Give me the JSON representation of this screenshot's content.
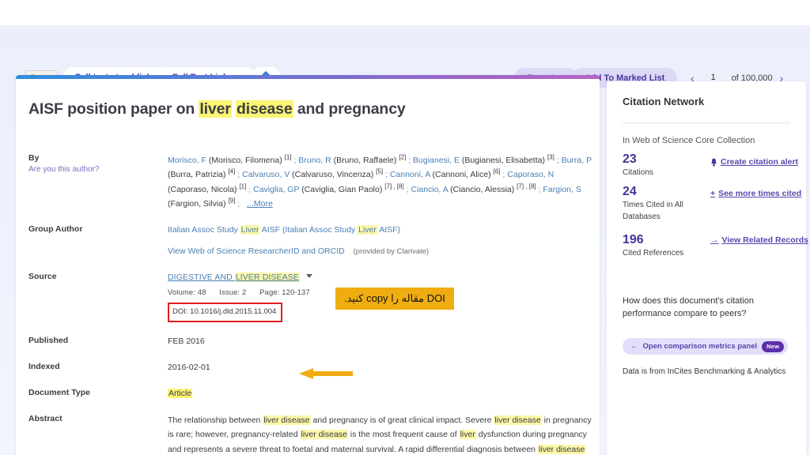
{
  "toolbar": {
    "find_it_label": "Find It",
    "find_it_icon": "circle-ring-icon",
    "full_text_publisher": "Full text at publisher",
    "full_text_links": "Full Text Links",
    "gem_icon": "blue-diamond-icon",
    "export_label": "Export",
    "add_to_marked_list": "Add To Marked List",
    "pager": {
      "prev_icon": "chevron-left-icon",
      "next_icon": "chevron-right-icon",
      "current": "1",
      "of_text": "of 100,000"
    }
  },
  "record": {
    "title_parts": [
      {
        "text": "AISF position paper on ",
        "highlight": false
      },
      {
        "text": "liver",
        "highlight": true
      },
      {
        "text": " ",
        "highlight": false
      },
      {
        "text": "disease",
        "highlight": true
      },
      {
        "text": " and pregnancy",
        "highlight": false
      }
    ],
    "title_plain": "AISF position paper on liver disease and pregnancy",
    "by_label": "By",
    "by_sublabel": "Are you this author?",
    "authors": [
      {
        "link": "Morisco, F",
        "full": "(Morisco, Filomena)",
        "refs": "[1]"
      },
      {
        "link": "Bruno, R",
        "full": "(Bruno, Raffaele)",
        "refs": "[2]"
      },
      {
        "link": "Bugianesi, E",
        "full": "(Bugianesi, Elisabetta)",
        "refs": "[3]"
      },
      {
        "link": "Burra, P",
        "full": "(Burra, Patrizia)",
        "refs": "[4]"
      },
      {
        "link": "Calvaruso, V",
        "full": "(Calvaruso, Vincenza)",
        "refs": "[5]"
      },
      {
        "link": "Cannoni, A",
        "full": "(Cannoni, Alice)",
        "refs": "[6]"
      },
      {
        "link": "Caporaso, N",
        "full": "(Caporaso, Nicola)",
        "refs": "[1]"
      },
      {
        "link": "Caviglia, GP",
        "full": "(Caviglia, Gian Paolo)",
        "refs": "[7] , [8]"
      },
      {
        "link": "Ciancio, A",
        "full": "(Ciancio, Alessia)",
        "refs": "[7] , [8]"
      },
      {
        "link": "Fargion, S",
        "full": "(Fargion, Silvia)",
        "refs": "[9]"
      }
    ],
    "authors_more": "...More",
    "group_author_label": "Group Author",
    "group_author_parts": [
      {
        "text": "Italian Assoc Study ",
        "highlight": false
      },
      {
        "text": "Liver",
        "highlight": true
      },
      {
        "text": " AISF (Italian Assoc Study ",
        "highlight": false
      },
      {
        "text": "Liver",
        "highlight": true
      },
      {
        "text": " AISF)",
        "highlight": false
      }
    ],
    "orcid_link": "View Web of Science ResearcherID and ORCID",
    "orcid_note": "(provided by Clarivate)",
    "source_label": "Source",
    "source_parts": [
      {
        "text": "DIGESTIVE AND ",
        "highlight": false
      },
      {
        "text": "LIVER DISEASE",
        "highlight": true
      }
    ],
    "source_caret_icon": "caret-down-icon",
    "source_details": [
      "Volume: 48",
      "Issue: 2",
      "Page: 120-137"
    ],
    "doi_text": "DOI: 10.1016/j.dld.2015.11.004",
    "published_label": "Published",
    "published_value": "FEB 2016",
    "indexed_label": "Indexed",
    "indexed_value": "2016-02-01",
    "doc_type_label": "Document Type",
    "doc_type_value": "Article",
    "abstract_label": "Abstract",
    "abstract_parts": [
      {
        "text": "The relationship between ",
        "highlight": false
      },
      {
        "text": "liver disease",
        "highlight": true
      },
      {
        "text": " and pregnancy is of great clinical impact. Severe ",
        "highlight": false
      },
      {
        "text": "liver disease",
        "highlight": true
      },
      {
        "text": " in pregnancy is rare; however, pregnancy-related ",
        "highlight": false
      },
      {
        "text": "liver disease",
        "highlight": true
      },
      {
        "text": " is the most frequent cause of ",
        "highlight": false
      },
      {
        "text": "liver",
        "highlight": true
      },
      {
        "text": " dysfunction during pregnancy and represents a severe threat to foetal and maternal survival. A rapid differential diagnosis between ",
        "highlight": false
      },
      {
        "text": "liver disease",
        "highlight": true
      }
    ]
  },
  "annotation": {
    "text": "DOI مقاله را copy کنید.",
    "arrow_icon": "left-arrow-icon",
    "background": "#f0ad12",
    "doi_outline_color": "#e02020"
  },
  "sidebar": {
    "title": "Citation Network",
    "collection_label": "In Web of Science Core Collection",
    "stats": [
      {
        "number": "23",
        "caption": "Citations"
      },
      {
        "number": "24",
        "caption": "Times Cited in All Databases"
      },
      {
        "number": "196",
        "caption": "Cited References"
      }
    ],
    "links": [
      {
        "label": "Create citation alert",
        "icon": "bell-icon"
      },
      {
        "label": "See more times cited",
        "icon": "plus-icon"
      },
      {
        "label": "View Related Records",
        "icon": "arrow-right-icon"
      }
    ],
    "peers_question": "How does this document's citation performance compare to peers?",
    "metrics_button": {
      "label": "Open comparison metrics panel",
      "icon": "arrow-left-icon",
      "badge": "New"
    },
    "incites_note": "Data is from InCites Benchmarking & Analytics"
  },
  "colors": {
    "accent_purple": "#5b47ae",
    "stat_purple": "#453397",
    "link_blue": "#4a7fb5",
    "highlight_yellow": "#fbf474",
    "annotation_orange": "#f0ad12",
    "page_bg": "#eef1fb"
  }
}
